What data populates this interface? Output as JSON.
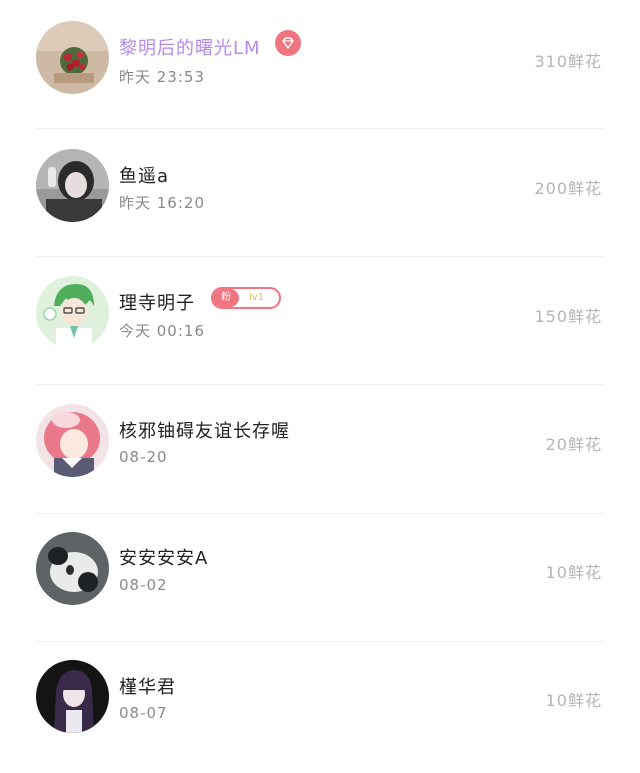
{
  "contacts": [
    {
      "name": "黎明后的曙光LM",
      "time": "昨天 23:53",
      "flowers": "310鲜花",
      "badge_icon": "diamond-icon",
      "vip_color": "#b48be8"
    },
    {
      "name": "鱼遥a",
      "time": "昨天 16:20",
      "flowers": "200鲜花"
    },
    {
      "name": "理寺明子",
      "time": "今天 00:16",
      "flowers": "150鲜花",
      "fan_badge": {
        "label": "粉",
        "level": "lv1"
      }
    },
    {
      "name": "核邪铀碍友谊长存喔",
      "time": "08-20",
      "flowers": "20鲜花"
    },
    {
      "name": "安安安安A",
      "time": "08-02",
      "flowers": "10鲜花"
    },
    {
      "name": "槿华君",
      "time": "08-07",
      "flowers": "10鲜花"
    }
  ],
  "colors": {
    "badge_pink": "#f17581",
    "fan_level_gold": "#e6b95a",
    "flowers_gray": "#b5b5b5",
    "time_gray": "#8a8a8a"
  }
}
